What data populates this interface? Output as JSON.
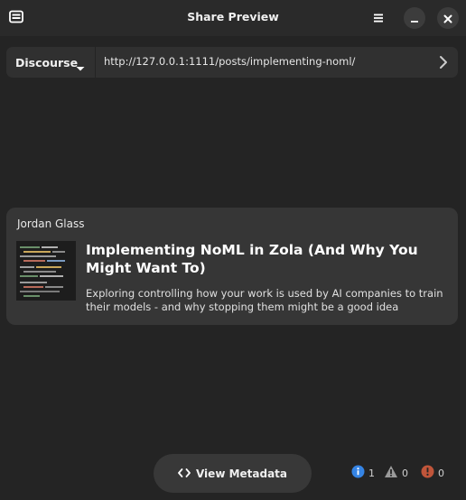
{
  "window": {
    "title": "Share Preview"
  },
  "address": {
    "service": "Discourse",
    "url": "http://127.0.0.1:1111/posts/implementing-noml/"
  },
  "card": {
    "site_name": "Jordan Glass",
    "title": "Implementing NoML in Zola (And Why You Might Want To)",
    "description": "Exploring controlling how your work is used by AI companies to train their models - and why stopping them might be a good idea"
  },
  "footer": {
    "metadata_label": "View Metadata",
    "info_count": "1",
    "warning_count": "0",
    "error_count": "0"
  },
  "colors": {
    "background": "#242424",
    "headerbar": "#2a2a2a",
    "card": "#363636",
    "info": "#3584e4",
    "warning": "#9a9a9a",
    "error": "#c0553a"
  },
  "icons": [
    "app-icon",
    "hamburger-menu-icon",
    "minimize-icon",
    "close-icon",
    "chevron-down-icon",
    "chevron-right-icon",
    "code-icon",
    "info-icon",
    "warning-icon",
    "error-icon"
  ]
}
